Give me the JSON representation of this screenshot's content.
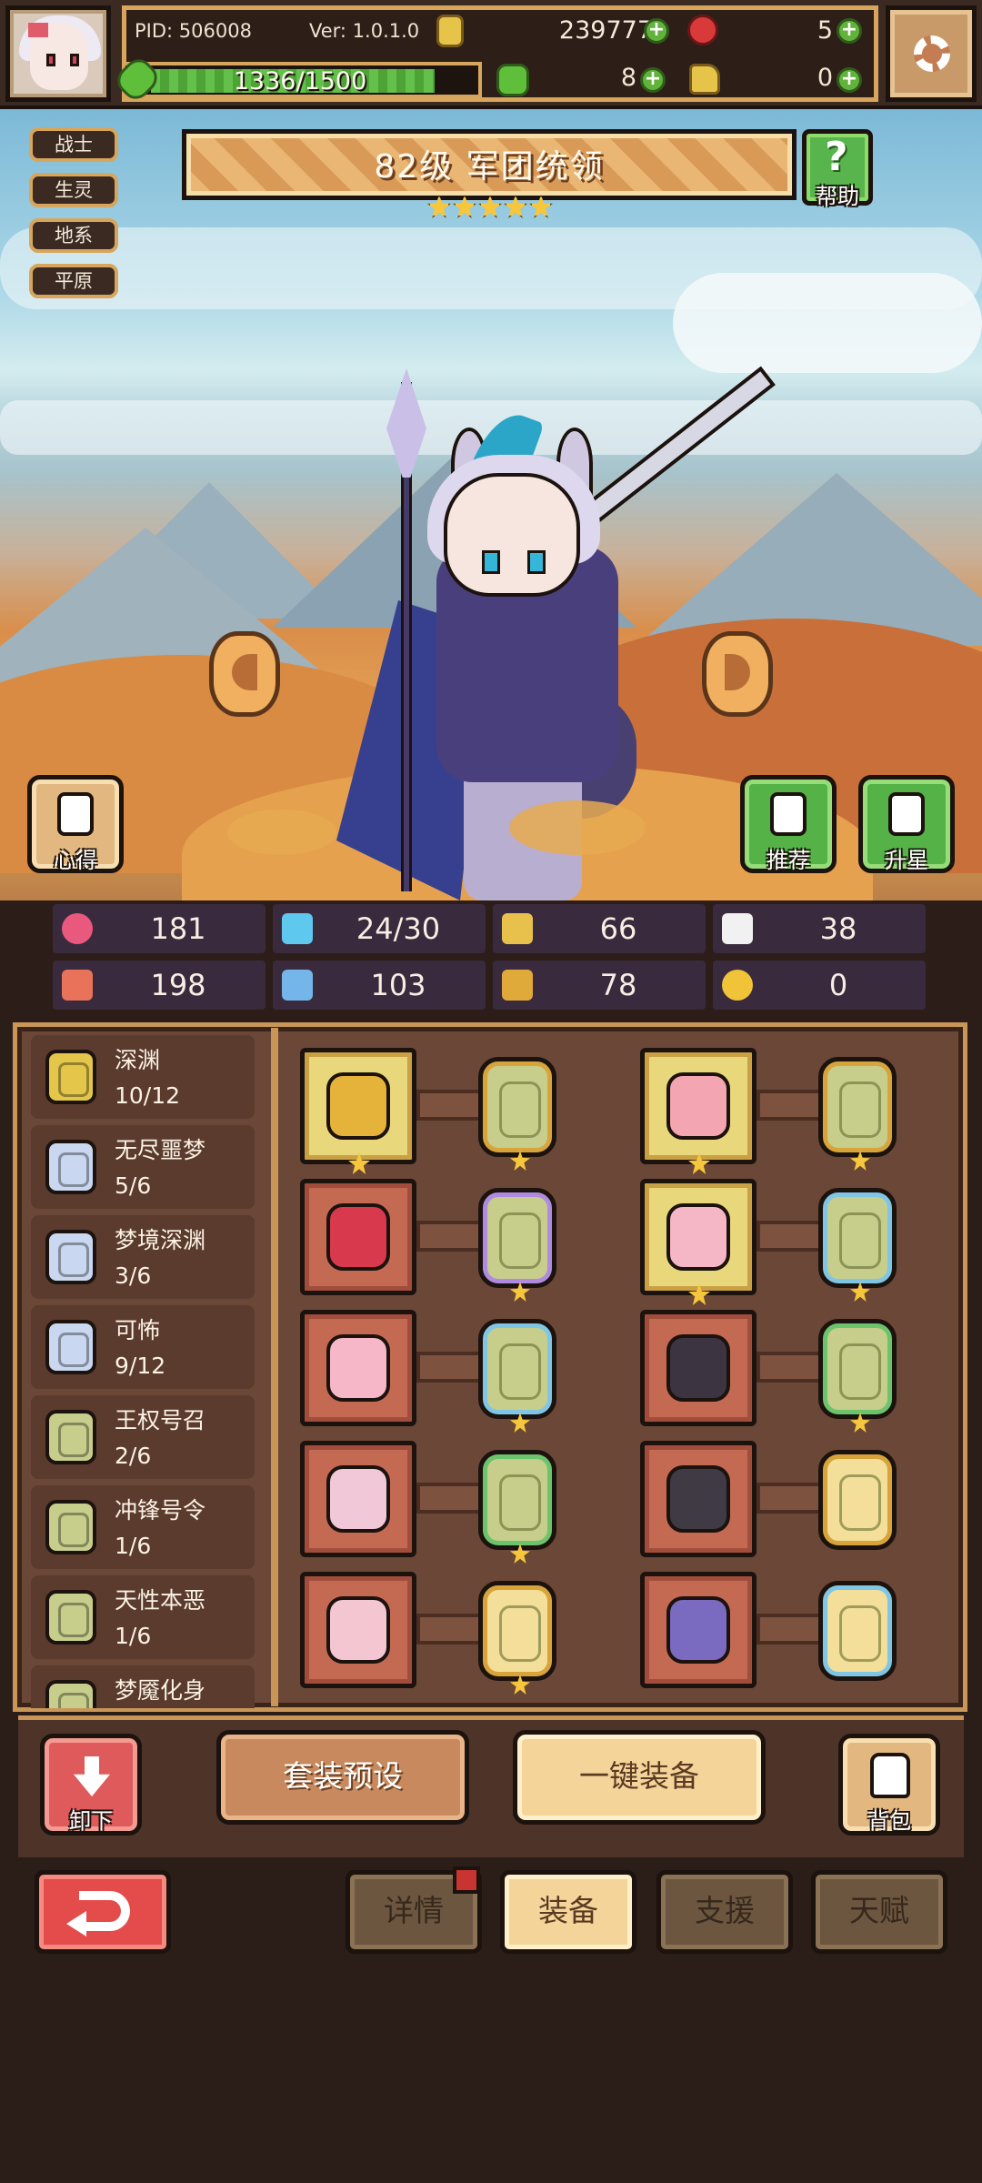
{
  "header": {
    "pid": "PID: 506008",
    "version": "Ver: 1.0.1.0",
    "gold": "239777",
    "gems": "5",
    "xp_text": "1336/1500",
    "xp_progress": 0.89,
    "energy": "8",
    "tokens": "0"
  },
  "hero": {
    "tags": [
      "战士",
      "生灵",
      "地系",
      "平原"
    ],
    "title": "82级  军团统领",
    "stars": 5,
    "help_label": "帮助",
    "tips_label": "心得",
    "recommend_label": "推荐",
    "star_up_label": "升星"
  },
  "stats": [
    {
      "icon": "heart-icon",
      "value": "181",
      "color": "#e8597d"
    },
    {
      "icon": "water-drop-icon",
      "value": "24/30",
      "color": "#5fc8ee"
    },
    {
      "icon": "shield-icon",
      "value": "66",
      "color": "#e8c14c"
    },
    {
      "icon": "wing-icon",
      "value": "38",
      "color": "#f1f1f1"
    },
    {
      "icon": "fist-icon",
      "value": "198",
      "color": "#e8725a"
    },
    {
      "icon": "book-icon",
      "value": "103",
      "color": "#74b6ea"
    },
    {
      "icon": "boot-icon",
      "value": "78",
      "color": "#e0aa3a"
    },
    {
      "icon": "horseshoe-icon",
      "value": "0",
      "color": "#f0c339"
    }
  ],
  "sets": [
    {
      "name": "深渊",
      "count": "10/12",
      "color": "#e3c64a"
    },
    {
      "name": "无尽噩梦",
      "count": "5/6",
      "color": "#c9d8f0"
    },
    {
      "name": "梦境深渊",
      "count": "3/6",
      "color": "#c9d8f0"
    },
    {
      "name": "可怖",
      "count": "9/12",
      "color": "#c9d8f0"
    },
    {
      "name": "王权号召",
      "count": "2/6",
      "color": "#c7ce8c"
    },
    {
      "name": "冲锋号令",
      "count": "1/6",
      "color": "#c7ce8c"
    },
    {
      "name": "天性本恶",
      "count": "1/6",
      "color": "#c7ce8c"
    },
    {
      "name": "梦魇化身",
      "count": "",
      "color": "#c7ce8c"
    }
  ],
  "equipment": [
    {
      "item": "staff-icon",
      "slot": "gold",
      "item_star": true,
      "rune_border": "#d8a43a",
      "rune_star": true,
      "rune": "rune-green"
    },
    {
      "item": "pig-mask-icon",
      "slot": "gold",
      "item_star": true,
      "rune_border": "#d8a43a",
      "rune_star": true,
      "rune": "rune-green"
    },
    {
      "item": "red-bear-icon",
      "slot": "red",
      "item_star": false,
      "rune_border": "#b08ae0",
      "rune_star": true,
      "rune": "rune-green"
    },
    {
      "item": "pink-dress-icon",
      "slot": "gold",
      "item_star": true,
      "rune_border": "#7fc6e6",
      "rune_star": true,
      "rune": "rune-green"
    },
    {
      "item": "heart-necklace-icon",
      "slot": "red",
      "item_star": false,
      "rune_border": "#7fc6e6",
      "rune_star": true,
      "rune": "rune-green"
    },
    {
      "item": "demon-helmet-icon",
      "slot": "red",
      "item_star": false,
      "rune_border": "#6bc46b",
      "rune_star": true,
      "rune": "rune-green"
    },
    {
      "item": "winged-heart-icon",
      "slot": "red",
      "item_star": false,
      "rune_border": "#6bc46b",
      "rune_star": true,
      "rune": "rune-green"
    },
    {
      "item": "dark-collar-icon",
      "slot": "red",
      "item_star": false,
      "rune_border": "#d8a43a",
      "rune_star": false,
      "rune": "rune-gold"
    },
    {
      "item": "heart-ring-icon",
      "slot": "red",
      "item_star": false,
      "rune_border": "#d8a43a",
      "rune_star": true,
      "rune": "rune-gold"
    },
    {
      "item": "armored-boots-icon",
      "slot": "red",
      "item_star": false,
      "rune_border": "#7fc6e6",
      "rune_star": false,
      "rune": "rune-gold"
    }
  ],
  "actions": {
    "unequip": "卸下",
    "preset": "套装预设",
    "equip_all": "一键装备",
    "bag": "背包"
  },
  "tabs": [
    {
      "label": "详情",
      "active": false,
      "badge": true
    },
    {
      "label": "装备",
      "active": true,
      "badge": false
    },
    {
      "label": "支援",
      "active": false,
      "badge": false
    },
    {
      "label": "天赋",
      "active": false,
      "badge": false
    }
  ]
}
